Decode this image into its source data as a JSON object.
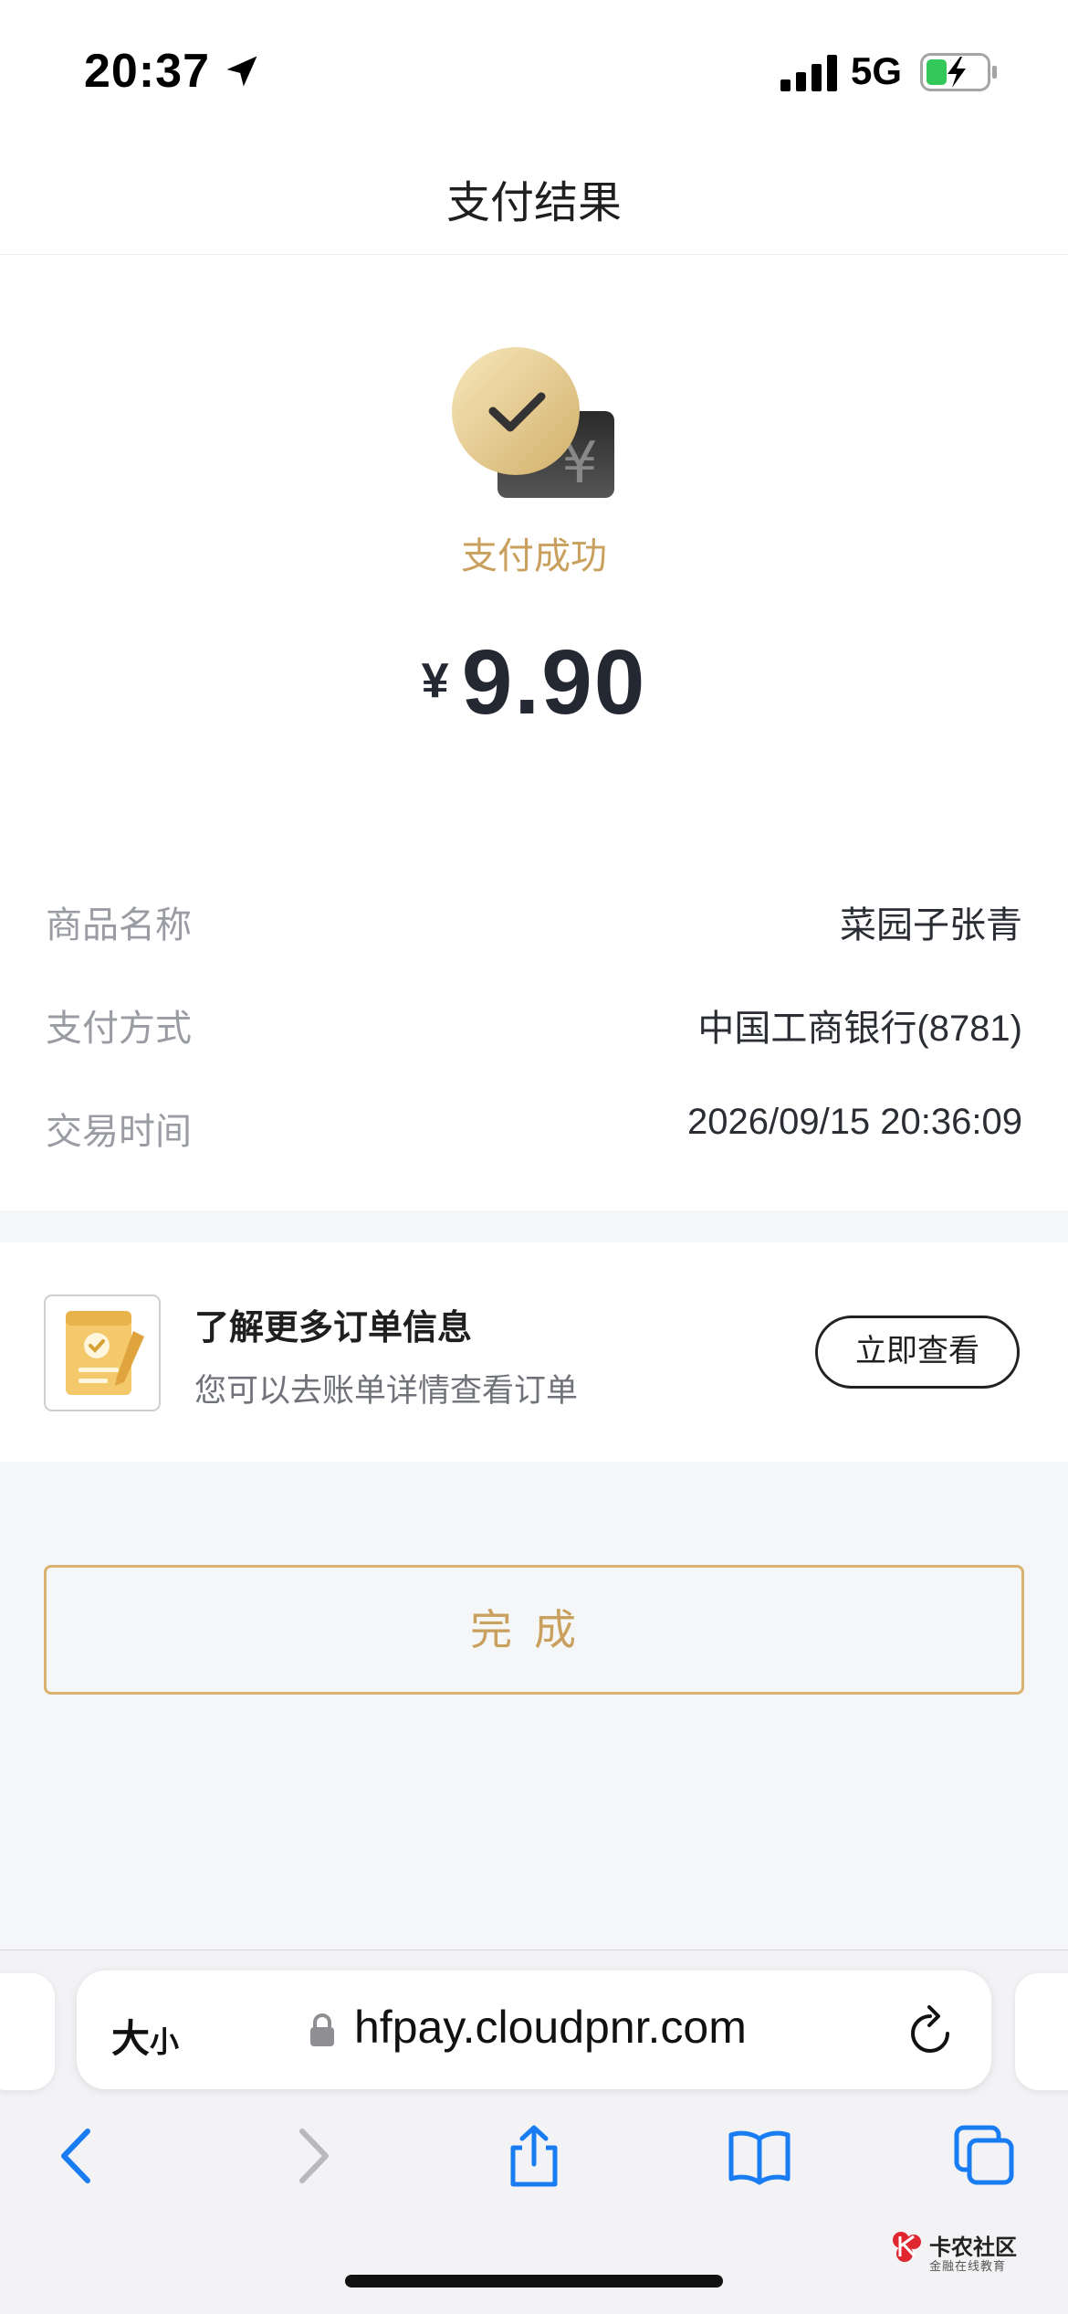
{
  "status_bar": {
    "time": "20:37",
    "network": "5G",
    "icons": [
      "location-arrow-icon",
      "cellular-signal-icon",
      "battery-charging-icon"
    ]
  },
  "nav": {
    "title": "支付结果"
  },
  "result": {
    "status_text": "支付成功",
    "currency_symbol": "¥",
    "amount": "9.90",
    "details": [
      {
        "label": "商品名称",
        "value": "菜园子张青"
      },
      {
        "label": "支付方式",
        "value": "中国工商银行(8781)"
      },
      {
        "label": "交易时间",
        "value": "2026/09/15 20:36:09"
      }
    ]
  },
  "info_card": {
    "title": "了解更多订单信息",
    "subtitle": "您可以去账单详情查看订单",
    "button_label": "立即查看"
  },
  "done_button": {
    "label": "完成"
  },
  "browser": {
    "text_size_big": "大",
    "text_size_small": "小",
    "url": "hfpay.cloudpnr.com",
    "toolbar": [
      "back-icon",
      "forward-icon",
      "share-icon",
      "bookmarks-icon",
      "tabs-icon"
    ]
  },
  "watermark": {
    "title": "卡农社区",
    "subtitle": "金融在线教育"
  },
  "colors": {
    "gold_accent": "#c9a05d",
    "ios_blue": "#1a7cf3",
    "amount_text": "#242833"
  }
}
